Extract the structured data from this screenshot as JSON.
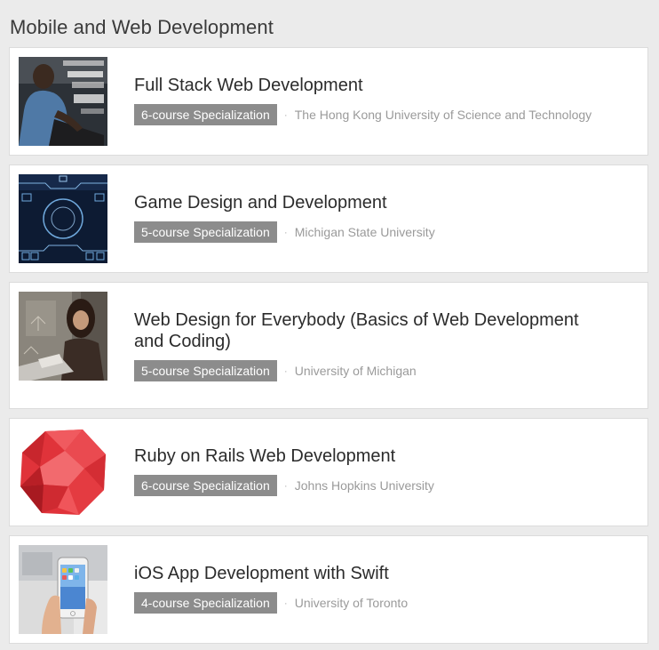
{
  "section": {
    "title": "Mobile and Web Development"
  },
  "courses": [
    {
      "title": "Full Stack Web Development",
      "badge": "6-course Specialization",
      "separator": "·",
      "university": "The Hong Kong University of Science and Technology",
      "thumbnail": "person-coding-laptop-image"
    },
    {
      "title": "Game Design and Development",
      "badge": "5-course Specialization",
      "separator": "·",
      "university": "Michigan State University",
      "thumbnail": "game-hud-interface-image"
    },
    {
      "title": "Web Design for Everybody (Basics of Web Development and Coding)",
      "badge": "5-course Specialization",
      "separator": "·",
      "university": "University of Michigan",
      "thumbnail": "woman-typing-laptop-image"
    },
    {
      "title": "Ruby on Rails Web Development",
      "badge": "6-course Specialization",
      "separator": "·",
      "university": "Johns Hopkins University",
      "thumbnail": "red-ruby-gem-image"
    },
    {
      "title": "iOS App Development with Swift",
      "badge": "4-course Specialization",
      "separator": "·",
      "university": "University of Toronto",
      "thumbnail": "hand-holding-iphone-image"
    }
  ],
  "colors": {
    "page_background": "#ebebeb",
    "card_background": "#ffffff",
    "badge_background": "#8c8c8c",
    "university_text": "#9a9a9a",
    "ruby_red": "#e0333a"
  }
}
